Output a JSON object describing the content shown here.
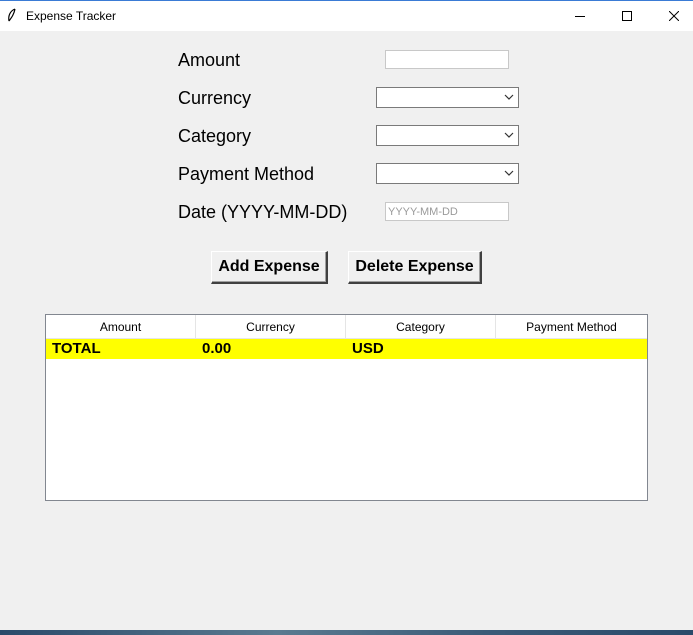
{
  "window": {
    "title": "Expense Tracker"
  },
  "form": {
    "amount_label": "Amount",
    "amount_value": "",
    "currency_label": "Currency",
    "currency_value": "",
    "category_label": "Category",
    "category_value": "",
    "payment_label": "Payment Method",
    "payment_value": "",
    "date_label": "Date (YYYY-MM-DD)",
    "date_placeholder": "YYYY-MM-DD"
  },
  "buttons": {
    "add": "Add Expense",
    "delete": "Delete Expense"
  },
  "table": {
    "columns": [
      "Amount",
      "Currency",
      "Category",
      "Payment Method"
    ],
    "total_row": [
      "TOTAL",
      "0.00",
      "USD",
      ""
    ],
    "total_row_color": "#ffff00"
  }
}
